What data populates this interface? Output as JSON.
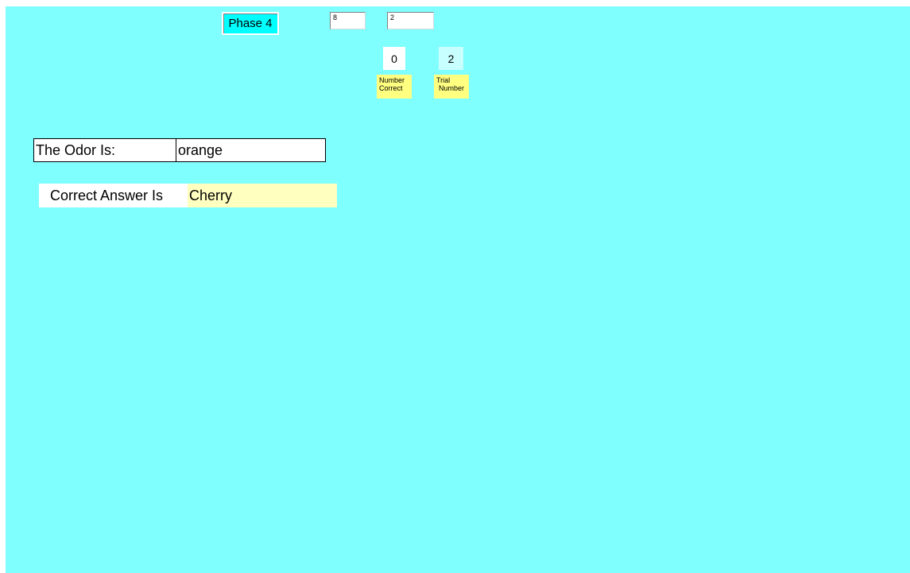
{
  "header": {
    "phase_label": "Phase 4",
    "input_1_value": "8",
    "input_2_value": "2"
  },
  "counters": {
    "number_correct": {
      "value": "0",
      "caption_line1": "Number",
      "caption_line2": "Correct"
    },
    "trial_number": {
      "value": "2",
      "caption_line1": "Trial",
      "caption_line2": "Number"
    }
  },
  "odor": {
    "label": "The Odor Is:",
    "value": "orange"
  },
  "answer": {
    "label": "Correct Answer Is",
    "value": "Cherry"
  },
  "colors": {
    "form_background": "#80ffff",
    "phase_background": "#00ffff",
    "caption_background": "#ffff80",
    "answer_value_background": "#ffffc0",
    "trial_value_background": "#c8ffff"
  }
}
